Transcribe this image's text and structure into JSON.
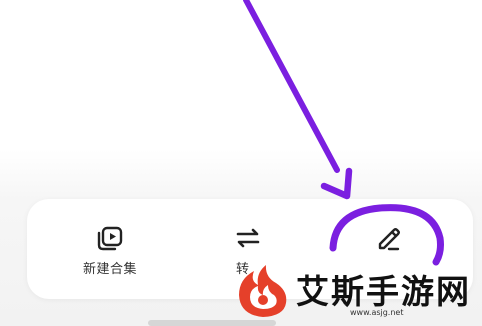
{
  "action_bar": {
    "items": [
      {
        "label": "新建合集",
        "icon": "video-collection-icon"
      },
      {
        "label": "转",
        "icon": "swap-arrows-icon"
      },
      {
        "label": "",
        "icon": "pencil-edit-icon"
      }
    ]
  },
  "annotation": {
    "color": "#7b1fe0",
    "shapes": [
      "arrow",
      "ellipse-highlight"
    ]
  },
  "watermark": {
    "title": "艾斯手游网",
    "url": "www.asjg.net",
    "logo_color": "#e5402a"
  }
}
